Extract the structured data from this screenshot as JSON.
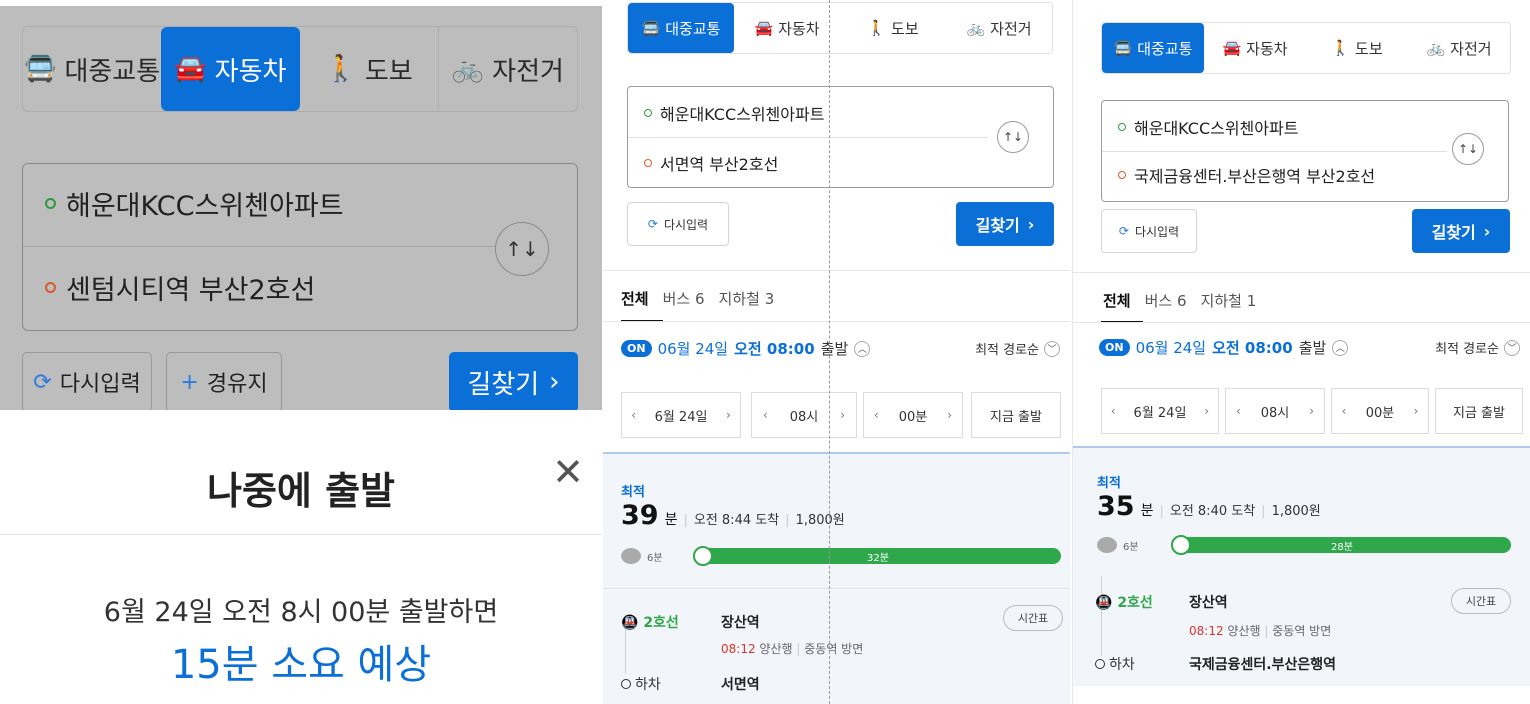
{
  "mode_tabs": [
    {
      "label": "대중교통",
      "icon": "bus-icon"
    },
    {
      "label": "자동차",
      "icon": "car-icon"
    },
    {
      "label": "도보",
      "icon": "walk-icon"
    },
    {
      "label": "자전거",
      "icon": "bike-icon"
    }
  ],
  "panel_a": {
    "origin": "해운대KCC스위첸아파트",
    "destination": "센텀시티역 부산2호선",
    "reset_label": "다시입력",
    "via_label": "경유지",
    "find_label": "길찾기",
    "sheet": {
      "title": "나중에 출발",
      "text": "6월 24일 오전 8시 00분 출발하면",
      "estimate": "15분 소요 예상"
    }
  },
  "panel_b": {
    "origin": "해운대KCC스위첸아파트",
    "destination": "서면역 부산2호선",
    "reset_label": "다시입력",
    "find_label": "길찾기",
    "tabs": [
      "전체",
      "버스 6",
      "지하철 3"
    ],
    "on_badge": "ON",
    "depart_date": "06월 24일",
    "depart_time": "오전 08:00",
    "depart_suffix": "출발",
    "sort_label": "최적 경로순",
    "picker_date": "6월 24일",
    "picker_hour": "08시",
    "picker_min": "00분",
    "now_label": "지금 출발",
    "best_label": "최적",
    "duration_num": "39",
    "duration_unit": "분",
    "arrival": "오전 8:44 도착",
    "fare": "1,800원",
    "walk_time": "6분",
    "ride_time": "32분",
    "line_label": "2호선",
    "board_station": "장산역",
    "timetable_label": "시간표",
    "dep_time": "08:12",
    "dep_direction": "양산행",
    "dep_toward": "중동역 방면",
    "alight_label": "하차",
    "alight_station": "서면역"
  },
  "panel_c": {
    "origin": "해운대KCC스위첸아파트",
    "destination": "국제금융센터.부산은행역 부산2호선",
    "reset_label": "다시입력",
    "find_label": "길찾기",
    "tabs": [
      "전체",
      "버스 6",
      "지하철 1"
    ],
    "on_badge": "ON",
    "depart_date": "06월 24일",
    "depart_time": "오전 08:00",
    "depart_suffix": "출발",
    "sort_label": "최적 경로순",
    "picker_date": "6월 24일",
    "picker_hour": "08시",
    "picker_min": "00분",
    "now_label": "지금 출발",
    "best_label": "최적",
    "duration_num": "35",
    "duration_unit": "분",
    "arrival": "오전 8:40 도착",
    "fare": "1,800원",
    "walk_time": "6분",
    "ride_time": "28분",
    "line_label": "2호선",
    "board_station": "장산역",
    "timetable_label": "시간표",
    "dep_time": "08:12",
    "dep_direction": "양산행",
    "dep_toward": "중동역 방면",
    "alight_label": "하차",
    "alight_station": "국제금융센터.부산은행역"
  },
  "colors": {
    "accent": "#0b6fd8",
    "line2": "#2ea84a",
    "depart_time_red": "#d9362b"
  }
}
